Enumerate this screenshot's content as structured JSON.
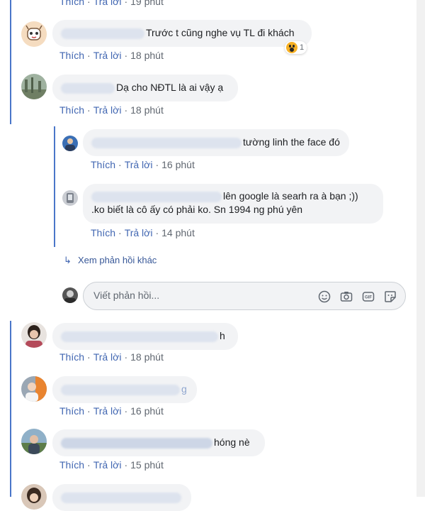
{
  "comments": [
    {
      "text_visible": "Trước t cũng nghe vụ TL đi khách",
      "like": "Thích",
      "reply": "Trả lời",
      "time": "19 phút"
    },
    {
      "text_visible": "Trước t cũng nghe vụ TL đi khách",
      "like": "Thích",
      "reply": "Trả lời",
      "time": "18 phút",
      "reaction_count": "1",
      "reaction_icon": "wow-reaction-icon"
    },
    {
      "text_visible": "Dạ cho NĐTL là ai vậy ạ",
      "like": "Thích",
      "reply": "Trả lời",
      "time": "18 phút"
    }
  ],
  "replies": [
    {
      "text": "tường linh the face đó",
      "like": "Thích",
      "reply": "Trả lời",
      "time": "16 phút"
    },
    {
      "text_line1": "lên google là searh ra à bạn ;))",
      "text_line2": ".ko biết là cô ấy có phải ko. Sn 1994 ng phú yên",
      "like": "Thích",
      "reply": "Trả lời",
      "time": "14 phút"
    }
  ],
  "more_replies": "Xem phản hồi khác",
  "composer": {
    "placeholder": "Viết phản hồi..."
  },
  "bottom_comments": [
    {
      "text": "h",
      "like": "Thích",
      "reply": "Trả lời",
      "time": "18 phút"
    },
    {
      "text": "g",
      "like": "Thích",
      "reply": "Trả lời",
      "time": "16 phút"
    },
    {
      "text": "hóng nè",
      "like": "Thích",
      "reply": "Trả lời",
      "time": "15 phút"
    }
  ],
  "colors": {
    "link": "#4267b2",
    "thread_line": "#4a76c9",
    "bubble": "#f2f3f5"
  }
}
